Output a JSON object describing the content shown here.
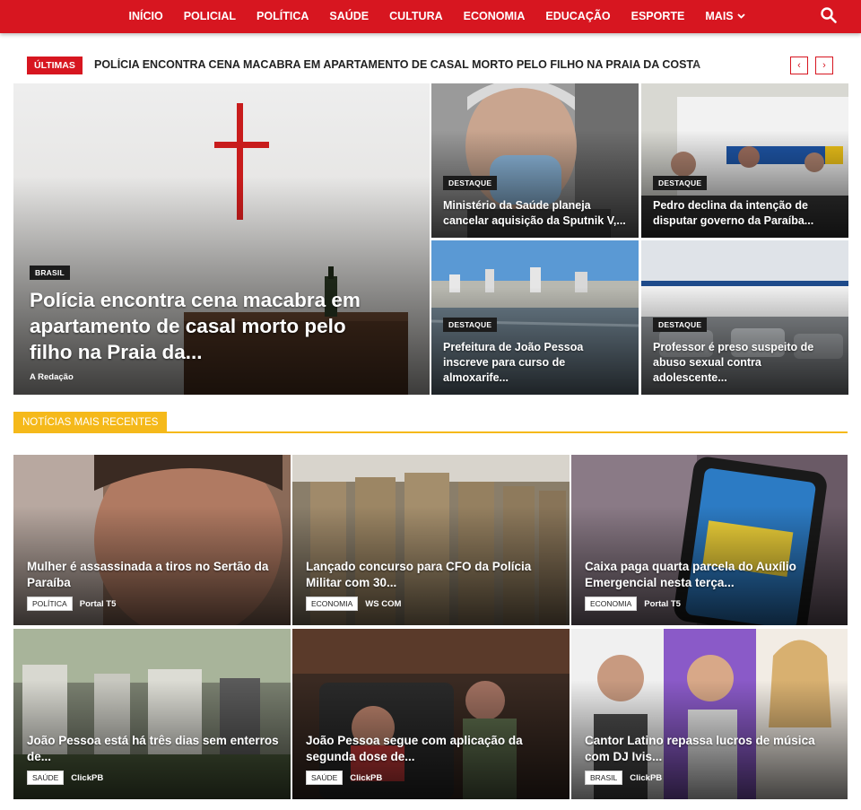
{
  "nav": {
    "items": [
      "INÍCIO",
      "POLICIAL",
      "POLÍTICA",
      "SAÚDE",
      "CULTURA",
      "ECONOMIA",
      "EDUCAÇÃO",
      "ESPORTE",
      "MAIS"
    ],
    "search_icon": "search-icon"
  },
  "ticker": {
    "badge": "ÚLTIMAS",
    "headline": "POLÍCIA ENCONTRA CENA MACABRA EM APARTAMENTO DE CASAL MORTO PELO FILHO NA PRAIA DA COSTA",
    "prev_icon": "chevron-left-icon",
    "next_icon": "chevron-right-icon",
    "prev_glyph": "‹",
    "next_glyph": "›"
  },
  "featured": {
    "main": {
      "tag": "BRASIL",
      "title": "Polícia encontra cena macabra em apartamento de casal morto pelo filho na Praia da...",
      "author": "A Redação"
    },
    "side": [
      {
        "tag": "DESTAQUE",
        "title": "Ministério da Saúde planeja cancelar aquisição da Sputnik V,..."
      },
      {
        "tag": "DESTAQUE",
        "title": "Pedro declina da intenção de disputar governo da Paraíba..."
      },
      {
        "tag": "DESTAQUE",
        "title": "Prefeitura de João Pessoa inscreve para curso de almoxarife..."
      },
      {
        "tag": "DESTAQUE",
        "title": "Professor é preso suspeito de abuso sexual contra adolescente..."
      }
    ]
  },
  "recent": {
    "heading": "NOTÍCIAS MAIS RECENTES",
    "cards": [
      {
        "title": "Mulher é assassinada a tiros no Sertão da Paraíba",
        "category": "POLÍTICA",
        "source": "Portal T5"
      },
      {
        "title": "Lançado concurso para CFO da Polícia Militar com 30...",
        "category": "ECONOMIA",
        "source": "WS COM"
      },
      {
        "title": "Caixa paga quarta parcela do Auxílio Emergencial nesta terça...",
        "category": "ECONOMIA",
        "source": "Portal T5"
      },
      {
        "title": "João Pessoa está há três dias sem enterros de...",
        "category": "SAÚDE",
        "source": "ClickPB"
      },
      {
        "title": "João Pessoa segue com aplicação da segunda dose de...",
        "category": "SAÚDE",
        "source": "ClickPB"
      },
      {
        "title": "Cantor Latino repassa lucros de música com DJ Ivis...",
        "category": "BRASIL",
        "source": "ClickPB"
      }
    ]
  },
  "colors": {
    "brand_red": "#d71620",
    "accent_yellow": "#f5b91a",
    "tag_dark": "#1c1c1c"
  }
}
